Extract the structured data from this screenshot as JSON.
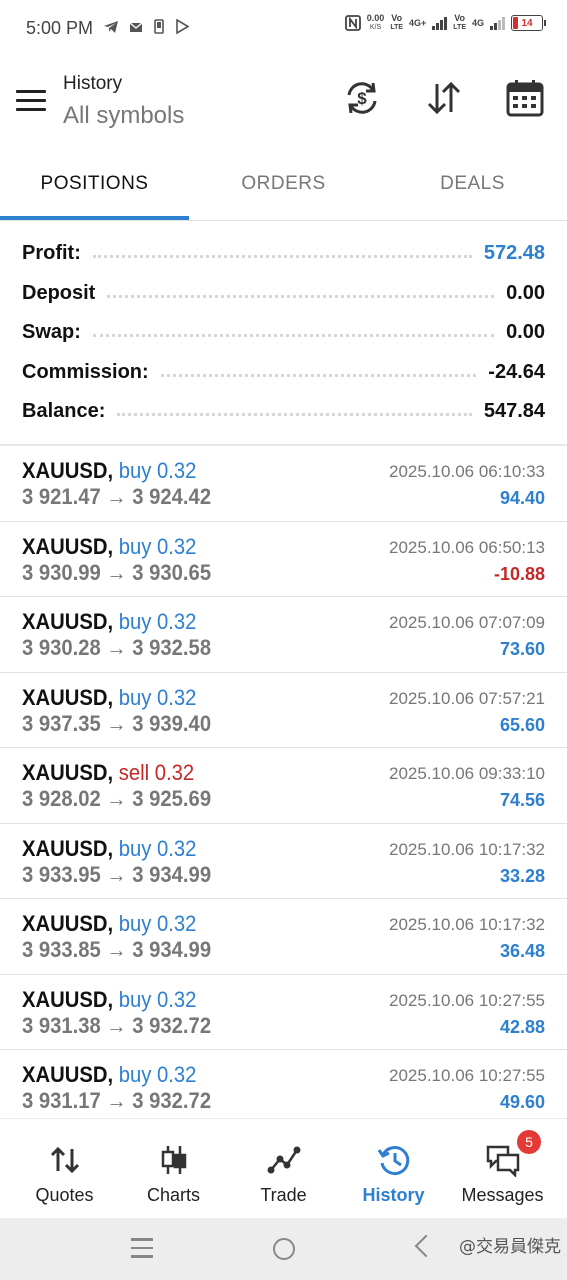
{
  "status_bar": {
    "time": "5:00 PM",
    "net_speed_value": "0.00",
    "net_speed_unit": "K/S",
    "battery": "14",
    "volte1": "Vo",
    "lte1": "LTE",
    "g4a": "4G+",
    "volte2": "Vo",
    "lte2": "LTE",
    "g4b": "4G"
  },
  "header": {
    "title": "History",
    "subtitle": "All symbols"
  },
  "tabs": [
    {
      "label": "POSITIONS",
      "active": true
    },
    {
      "label": "ORDERS",
      "active": false
    },
    {
      "label": "DEALS",
      "active": false
    }
  ],
  "summary": [
    {
      "label": "Profit:",
      "value": "572.48",
      "highlight": true
    },
    {
      "label": "Deposit",
      "value": "0.00"
    },
    {
      "label": "Swap:",
      "value": "0.00"
    },
    {
      "label": "Commission:",
      "value": "-24.64"
    },
    {
      "label": "Balance:",
      "value": "547.84"
    }
  ],
  "deals": [
    {
      "symbol": "XAUUSD,",
      "side": "buy 0.32",
      "type": "buy",
      "open": "3 921.47",
      "close": "3 924.42",
      "time": "2025.10.06 06:10:33",
      "profit": "94.40",
      "negative": false
    },
    {
      "symbol": "XAUUSD,",
      "side": "buy 0.32",
      "type": "buy",
      "open": "3 930.99",
      "close": "3 930.65",
      "time": "2025.10.06 06:50:13",
      "profit": "-10.88",
      "negative": true
    },
    {
      "symbol": "XAUUSD,",
      "side": "buy 0.32",
      "type": "buy",
      "open": "3 930.28",
      "close": "3 932.58",
      "time": "2025.10.06 07:07:09",
      "profit": "73.60",
      "negative": false
    },
    {
      "symbol": "XAUUSD,",
      "side": "buy 0.32",
      "type": "buy",
      "open": "3 937.35",
      "close": "3 939.40",
      "time": "2025.10.06 07:57:21",
      "profit": "65.60",
      "negative": false
    },
    {
      "symbol": "XAUUSD,",
      "side": "sell 0.32",
      "type": "sell",
      "open": "3 928.02",
      "close": "3 925.69",
      "time": "2025.10.06 09:33:10",
      "profit": "74.56",
      "negative": false
    },
    {
      "symbol": "XAUUSD,",
      "side": "buy 0.32",
      "type": "buy",
      "open": "3 933.95",
      "close": "3 934.99",
      "time": "2025.10.06 10:17:32",
      "profit": "33.28",
      "negative": false
    },
    {
      "symbol": "XAUUSD,",
      "side": "buy 0.32",
      "type": "buy",
      "open": "3 933.85",
      "close": "3 934.99",
      "time": "2025.10.06 10:17:32",
      "profit": "36.48",
      "negative": false
    },
    {
      "symbol": "XAUUSD,",
      "side": "buy 0.32",
      "type": "buy",
      "open": "3 931.38",
      "close": "3 932.72",
      "time": "2025.10.06 10:27:55",
      "profit": "42.88",
      "negative": false
    },
    {
      "symbol": "XAUUSD,",
      "side": "buy 0.32",
      "type": "buy",
      "open": "3 931.17",
      "close": "3 932.72",
      "time": "2025.10.06 10:27:55",
      "profit": "49.60",
      "negative": false
    }
  ],
  "bottom_nav": [
    {
      "label": "Quotes",
      "icon": "quotes-icon"
    },
    {
      "label": "Charts",
      "icon": "charts-icon"
    },
    {
      "label": "Trade",
      "icon": "trade-icon"
    },
    {
      "label": "History",
      "icon": "history-icon",
      "active": true
    },
    {
      "label": "Messages",
      "icon": "messages-icon",
      "badge": "5"
    }
  ],
  "watermark": "@交易員傑克",
  "colors": {
    "accent": "#2d7fd0",
    "negative": "#c62828",
    "badge": "#e53935"
  }
}
